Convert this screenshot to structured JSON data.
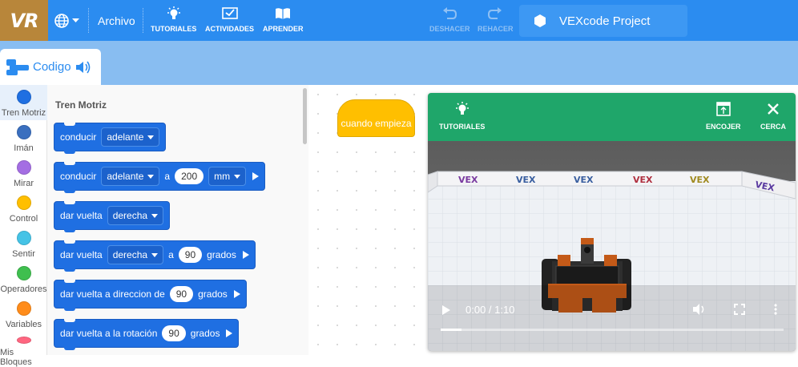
{
  "app": {
    "logo": "VR",
    "project_name": "VEXcode Project"
  },
  "toolbar": {
    "globe_icon": "globe-icon",
    "file_label": "Archivo",
    "tutorials_label": "TUTORIALES",
    "activities_label": "ACTIVIDADES",
    "learn_label": "APRENDER",
    "undo_label": "DESHACER",
    "redo_label": "REHACER"
  },
  "tabs": {
    "code_label": "Codigo"
  },
  "categories": [
    {
      "label": "Tren Motriz",
      "color": "#1f6fe2"
    },
    {
      "label": "Imán",
      "color": "#3a6fbf"
    },
    {
      "label": "Mirar",
      "color": "#a46ee3"
    },
    {
      "label": "Control",
      "color": "#ffbf00"
    },
    {
      "label": "Sentir",
      "color": "#45c3e6"
    },
    {
      "label": "Operadores",
      "color": "#3fbf4f"
    },
    {
      "label": "Variables",
      "color": "#ff8c1a"
    },
    {
      "label": "Mis Bloques",
      "color": "#ff6680"
    }
  ],
  "palette": {
    "title": "Tren Motriz",
    "blocks": [
      {
        "text1": "conducir",
        "dd1": "adelante"
      },
      {
        "text1": "conducir",
        "dd1": "adelante",
        "text2": "a",
        "num": "200",
        "dd2": "mm"
      },
      {
        "text1": "dar vuelta",
        "dd1": "derecha"
      },
      {
        "text1": "dar vuelta",
        "dd1": "derecha",
        "text2": "a",
        "num": "90",
        "text3": "grados"
      },
      {
        "text1": "dar vuelta a direccion de",
        "num": "90",
        "text3": "grados"
      },
      {
        "text1": "dar vuelta a la rotación",
        "num": "90",
        "text3": "grados"
      }
    ]
  },
  "workspace": {
    "hat_block": "cuando empieza"
  },
  "playground": {
    "tutorials_label": "TUTORIALES",
    "shrink_label": "ENCOJER",
    "close_label": "CERCA",
    "banner_text": "VEX",
    "time": "0:00 / 1:10",
    "progress": 0.06
  }
}
